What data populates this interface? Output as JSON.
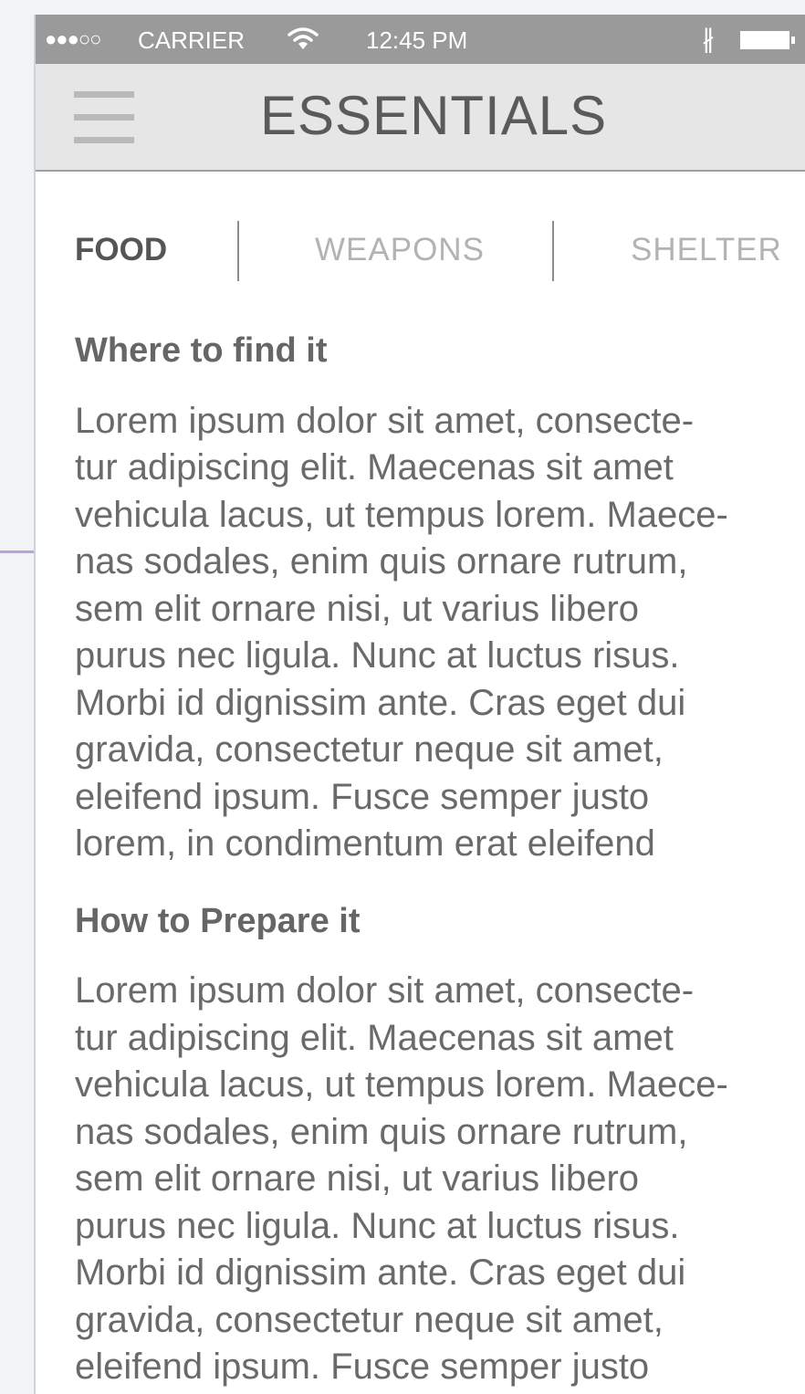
{
  "status_bar": {
    "signal": "●●●○○",
    "carrier": "CARRIER",
    "time": "12:45 PM",
    "bluetooth": "∦"
  },
  "nav": {
    "title": "ESSENTIALS",
    "menu_icon": "hamburger-menu-icon"
  },
  "tabs": [
    {
      "label": "FOOD",
      "active": true
    },
    {
      "label": "WEAPONS",
      "active": false
    },
    {
      "label": "SHELTER",
      "active": false
    }
  ],
  "sections": [
    {
      "heading": "Where to find it",
      "body": "Lorem ipsum dolor sit amet, consecte-\ntur adipiscing elit. Maecenas sit amet\nvehicula lacus, ut tempus lorem. Maece-\nnas sodales, enim quis ornare rutrum,\nsem elit ornare nisi, ut varius libero\npurus nec ligula. Nunc at luctus risus.\nMorbi id dignissim ante. Cras eget dui\ngravida, consectetur neque sit amet,\neleifend ipsum. Fusce semper justo\nlorem, in condimentum erat eleifend"
    },
    {
      "heading": "How to Prepare it",
      "body": "Lorem ipsum dolor sit amet, consecte-\ntur adipiscing elit. Maecenas sit amet\nvehicula lacus, ut tempus lorem. Maece-\nnas sodales, enim quis ornare rutrum,\nsem elit ornare nisi, ut varius libero\npurus nec ligula. Nunc at luctus risus.\nMorbi id dignissim ante. Cras eget dui\ngravida, consectetur neque sit amet,\neleifend ipsum. Fusce semper justo"
    }
  ],
  "colors": {
    "status_bar": "#9a9a9a",
    "nav_bar": "#e6e6e6",
    "active_tab": "#555555",
    "inactive_tab": "#b3b3b3",
    "connector": "#b7a3de"
  }
}
